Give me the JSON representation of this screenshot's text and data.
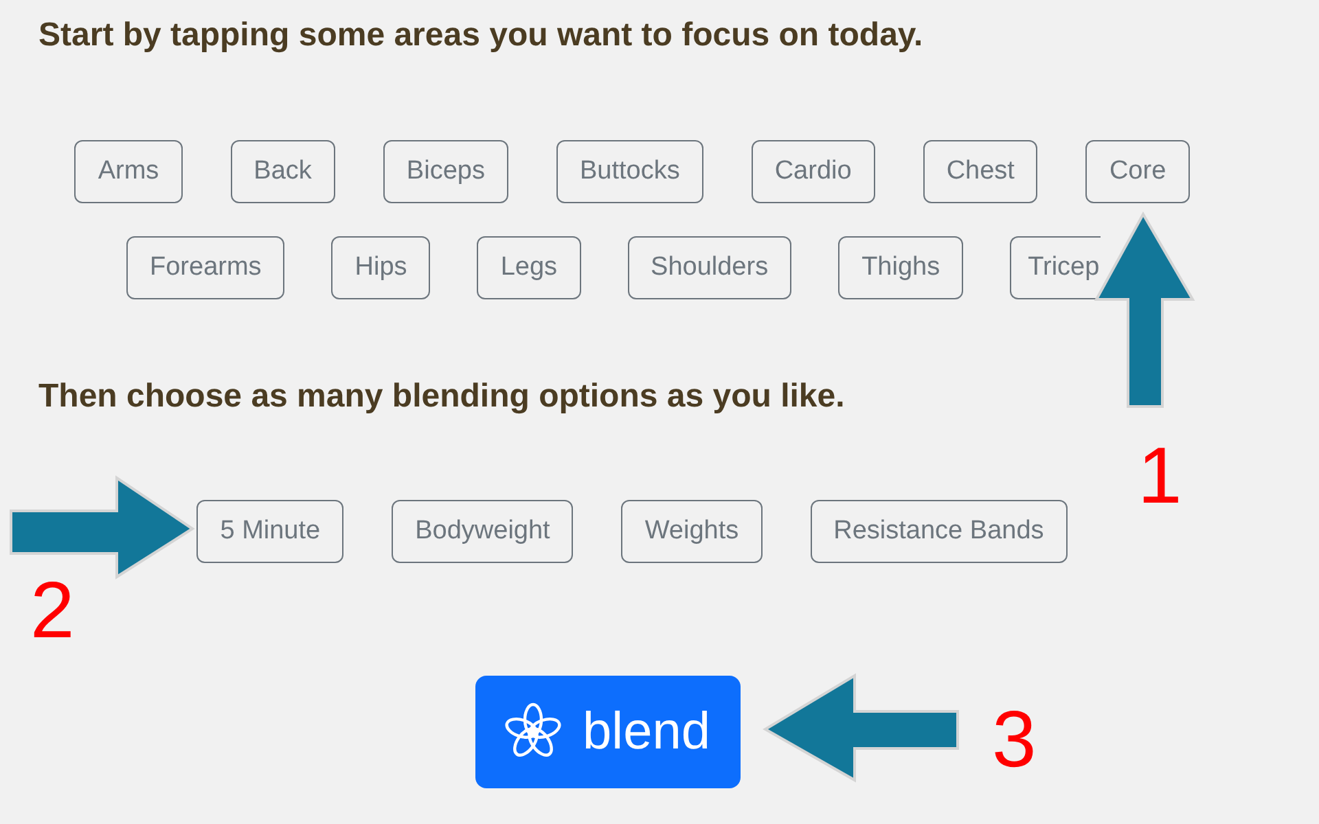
{
  "areas_heading": "Start by tapping some areas you want to focus on today.",
  "areas": [
    {
      "label": "Arms"
    },
    {
      "label": "Back"
    },
    {
      "label": "Biceps"
    },
    {
      "label": "Buttocks"
    },
    {
      "label": "Cardio"
    },
    {
      "label": "Chest"
    },
    {
      "label": "Core"
    },
    {
      "label": "Forearms"
    },
    {
      "label": "Hips"
    },
    {
      "label": "Legs"
    },
    {
      "label": "Shoulders"
    },
    {
      "label": "Thighs"
    },
    {
      "label": "Tricep"
    }
  ],
  "options_heading": "Then choose as many blending options as you like.",
  "options": [
    {
      "label": "5 Minute"
    },
    {
      "label": "Bodyweight"
    },
    {
      "label": "Weights"
    },
    {
      "label": "Resistance Bands"
    }
  ],
  "blend_button": {
    "label": "blend"
  },
  "annotations": [
    {
      "label": "1",
      "kind": "up"
    },
    {
      "label": "2",
      "kind": "right"
    },
    {
      "label": "3",
      "kind": "left"
    }
  ]
}
